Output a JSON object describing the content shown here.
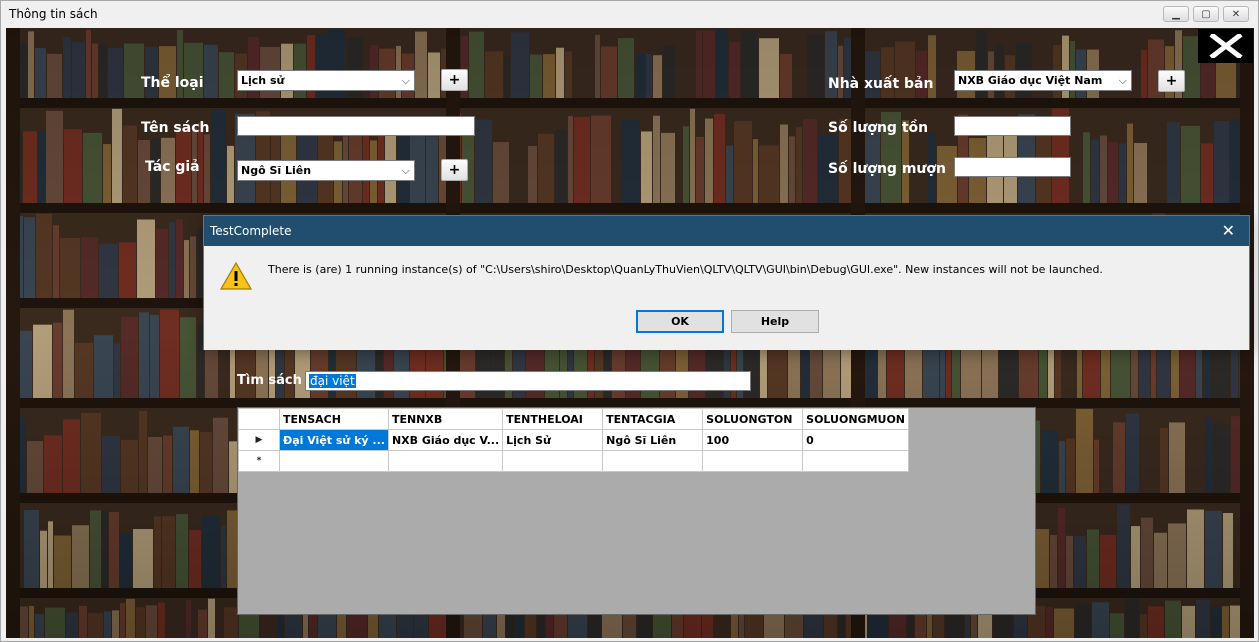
{
  "window": {
    "title": "Thông tin sách",
    "minimize": "▁",
    "maximize": "▢",
    "close": "✕"
  },
  "form": {
    "the_loai_label": "Thể loại",
    "the_loai_value": "Lịch sử",
    "ten_sach_label": "Tên sách",
    "ten_sach_value": "",
    "tac_gia_label": "Tác giả",
    "tac_gia_value": "Ngô Sĩ Liên",
    "nxb_label": "Nhà xuất bản",
    "nxb_value": "NXB Giáo dục Việt Nam",
    "so_luong_ton_label": "Số lượng tồn",
    "so_luong_ton_value": "",
    "so_luong_muon_label": "Số lượng mượn",
    "so_luong_muon_value": "",
    "plus_label": "+",
    "combo_arrow": "⌵"
  },
  "search": {
    "label": "Tìm sách",
    "value": "đại việt"
  },
  "grid": {
    "columns": [
      "TENSACH",
      "TENNXB",
      "TENTHELOAI",
      "TENTACGIA",
      "SOLUONGTON",
      "SOLUONGMUON"
    ],
    "rows": [
      [
        "Đại Việt sử ký ...",
        "NXB Giáo dục V...",
        "Lịch Sử",
        "Ngô Sĩ Liên",
        "100",
        "0"
      ]
    ],
    "current_row_marker": "▶",
    "new_row_marker": "*"
  },
  "dialog": {
    "title": "TestComplete",
    "close": "✕",
    "message": "There is (are) 1 running instance(s) of \"C:\\Users\\shiro\\Desktop\\QuanLyThuVien\\QLTV\\QLTV\\GUI\\bin\\Debug\\GUI.exe\". New instances will not be launched.",
    "ok_label": "OK",
    "help_label": "Help"
  }
}
